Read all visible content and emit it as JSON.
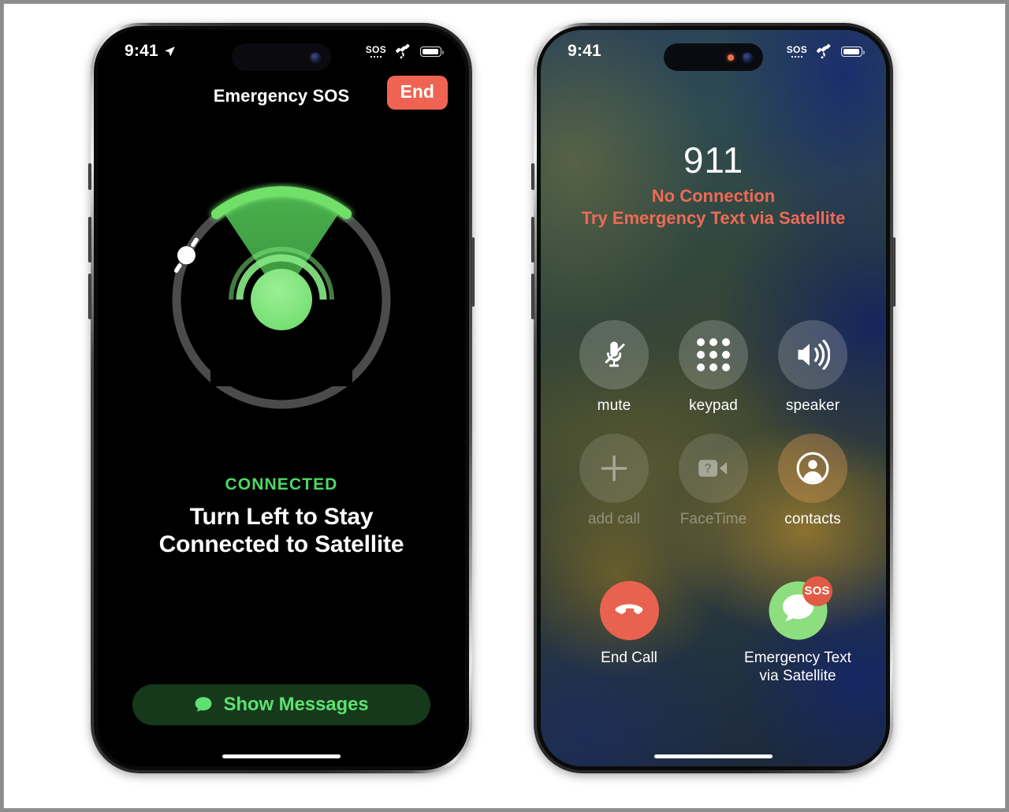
{
  "page": {
    "background_color": "#ffffff",
    "outer_border_color": "#8c8c8c"
  },
  "phones": {
    "left": {
      "name": "emergency-sos-satellite-screen",
      "status_bar": {
        "time": "9:41",
        "location_icon": "location-arrow-icon",
        "sos_label": "SOS",
        "satellite_icon": "satellite-icon",
        "battery_icon": "battery-full-icon"
      },
      "nav": {
        "title": "Emergency SOS",
        "end_label": "End"
      },
      "dial": {
        "icon": "satellite-pointing-dial",
        "ring_color": "#4a4a4a",
        "cone_color": "#4CB950",
        "arc_color": "#6FE069",
        "node_color": "#7FE37D",
        "marker_color": "#ffffff",
        "cone_center_deg": 90,
        "cone_span_deg": 74,
        "marker_angle_deg": 250
      },
      "status_label": "CONNECTED",
      "status_label_color": "#4CD964",
      "guidance_line1": "Turn Left to Stay",
      "guidance_line2": "Connected to Satellite",
      "show_messages": {
        "label": "Show Messages",
        "icon": "message-bubble-icon",
        "background_color": "#16391c",
        "text_color": "#5ee071"
      }
    },
    "right": {
      "name": "emergency-911-call-screen",
      "status_bar": {
        "time": "9:41",
        "sos_label": "SOS",
        "satellite_icon": "satellite-icon",
        "battery_icon": "battery-full-icon"
      },
      "callee": {
        "number": "911",
        "status_line1": "No Connection",
        "status_line2": "Try Emergency Text via Satellite",
        "status_color": "#ef6a55"
      },
      "controls": [
        {
          "id": "mute",
          "label": "mute",
          "icon": "microphone-slash-icon",
          "enabled": true
        },
        {
          "id": "keypad",
          "label": "keypad",
          "icon": "keypad-grid-icon",
          "enabled": true
        },
        {
          "id": "speaker",
          "label": "speaker",
          "icon": "speaker-wave-icon",
          "enabled": true
        },
        {
          "id": "add-call",
          "label": "add call",
          "icon": "plus-icon",
          "enabled": false
        },
        {
          "id": "facetime",
          "label": "FaceTime",
          "icon": "facetime-video-icon",
          "enabled": false
        },
        {
          "id": "contacts",
          "label": "contacts",
          "icon": "person-circle-icon",
          "enabled": true
        }
      ],
      "end_call": {
        "label": "End Call",
        "icon": "phone-down-icon",
        "color": "#e9624f"
      },
      "emergency_text": {
        "label_line1": "Emergency Text",
        "label_line2": "via Satellite",
        "icon": "message-bubble-icon",
        "badge_label": "SOS",
        "color": "#8DDE7E",
        "badge_color": "#e05a44"
      }
    }
  }
}
